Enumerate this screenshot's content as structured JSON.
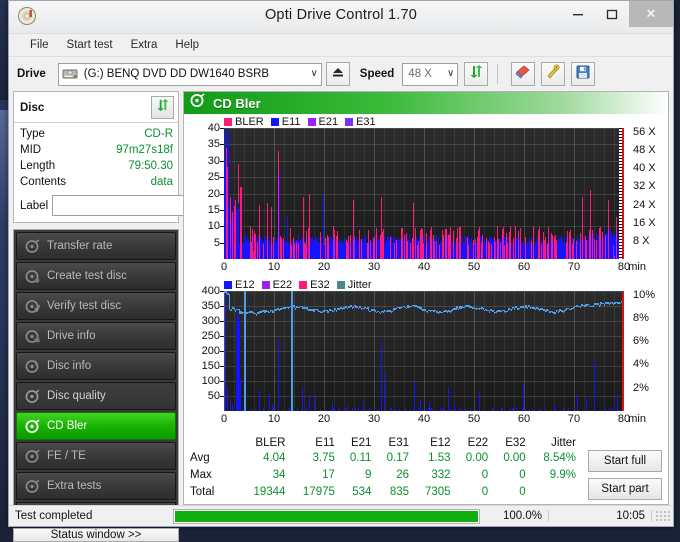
{
  "window": {
    "title": "Opti Drive Control 1.70",
    "app_icon": "disc-icon",
    "buttons": {
      "minimize": "–",
      "maximize": "□",
      "close": "✕"
    }
  },
  "menubar": {
    "items": [
      "File",
      "Start test",
      "Extra",
      "Help"
    ]
  },
  "toolbar": {
    "drive_label": "Drive",
    "drive_value": "(G:)   BENQ DVD DD DW1640 BSRB",
    "drive_icon": "drive-icon",
    "eject_icon": "eject-icon",
    "speed_label": "Speed",
    "speed_value": "48 X",
    "refresh_icon": "refresh-icon",
    "eraser_icon": "eraser-icon",
    "tools_icon": "tools-icon",
    "save_icon": "save-icon",
    "dropdown_arrow": "∨"
  },
  "disc_panel": {
    "title": "Disc",
    "refresh_icon": "refresh-icon",
    "rows": [
      {
        "key": "Type",
        "value": "CD-R"
      },
      {
        "key": "MID",
        "value": "97m27s18f"
      },
      {
        "key": "Length",
        "value": "79:50.30"
      },
      {
        "key": "Contents",
        "value": "data"
      }
    ],
    "label_key": "Label",
    "label_value": "",
    "label_placeholder": "",
    "cd_icon": "cd-icon"
  },
  "test_list": {
    "items": [
      {
        "label": "Transfer rate",
        "icon": "disc-test-icon",
        "active": false
      },
      {
        "label": "Create test disc",
        "icon": "disc-burn-icon",
        "active": false
      },
      {
        "label": "Verify test disc",
        "icon": "disc-verify-icon",
        "active": false
      },
      {
        "label": "Drive info",
        "icon": "drive-info-icon",
        "active": false
      },
      {
        "label": "Disc info",
        "icon": "disc-info-icon",
        "active": false
      },
      {
        "label": "Disc quality",
        "icon": "disc-quality-icon",
        "active": false
      },
      {
        "label": "CD Bler",
        "icon": "cd-bler-icon",
        "active": true
      },
      {
        "label": "FE / TE",
        "icon": "fe-te-icon",
        "active": false
      },
      {
        "label": "Extra tests",
        "icon": "extra-tests-icon",
        "active": false
      }
    ],
    "status_window_label": "Status window >>"
  },
  "main": {
    "panel_title": "CD Bler",
    "panel_icon": "cd-bler-icon",
    "start_full_label": "Start full",
    "start_part_label": "Start part"
  },
  "colors": {
    "bler": "#ff1a7a",
    "e11": "#1414ff",
    "e21": "#a020f0",
    "e31": "#7b2ff7",
    "e12": "#1414ff",
    "e22": "#a020f0",
    "e32": "#ff1a7a",
    "jitter": "#4d9ee8",
    "accent_green": "#16b000",
    "value_green": "#0a8f2c",
    "plot_bg": "#232323",
    "red_edge": "#e01010"
  },
  "statusbar": {
    "message": "Test completed",
    "percent_label": "100.0%",
    "percent_value": 100,
    "elapsed": "10:05"
  },
  "stats": {
    "columns": [
      "BLER",
      "E11",
      "E21",
      "E31",
      "E12",
      "E22",
      "E32",
      "Jitter"
    ],
    "rows": [
      {
        "name": "Avg",
        "values": [
          "4.04",
          "3.75",
          "0.11",
          "0.17",
          "1.53",
          "0.00",
          "0.00",
          "8.54%"
        ]
      },
      {
        "name": "Max",
        "values": [
          "34",
          "17",
          "9",
          "26",
          "332",
          "0",
          "0",
          "9.9%"
        ]
      },
      {
        "name": "Total",
        "values": [
          "19344",
          "17975",
          "534",
          "835",
          "7305",
          "0",
          "0",
          ""
        ]
      }
    ]
  },
  "chart_data": [
    {
      "type": "area",
      "id": "cd-bler-chart",
      "title": "CD Bler",
      "xlabel": "min",
      "ylabel": "",
      "xlim": [
        0,
        80
      ],
      "ylim": [
        0,
        40
      ],
      "xticks": [
        0,
        10,
        20,
        30,
        40,
        50,
        60,
        70,
        80
      ],
      "yticks": [
        5,
        10,
        15,
        20,
        25,
        30,
        35,
        40
      ],
      "y2label": "X",
      "y2ticks": [
        "8 X",
        "16 X",
        "24 X",
        "32 X",
        "40 X",
        "48 X",
        "56 X"
      ],
      "y2lim": [
        0,
        56
      ],
      "grid": true,
      "legend": [
        {
          "name": "BLER",
          "color": "#ff1a7a"
        },
        {
          "name": "E11",
          "color": "#1414ff"
        },
        {
          "name": "E21",
          "color": "#a020f0"
        },
        {
          "name": "E31",
          "color": "#7b2ff7"
        }
      ],
      "notes": "Dense noise band: E11 (blue) fill avg ~4-8, BLER (pink) spikes to 34 near 0 min and 33 near 11 min; baseline rises slightly after 70 min.",
      "seed": 1337,
      "series": [
        {
          "name": "E11",
          "color": "#1414ff",
          "baseline": 5.5,
          "noise": 3.2,
          "avg": 3.75,
          "max": 17
        },
        {
          "name": "BLER",
          "color": "#ff1a7a",
          "baseline": 6.0,
          "noise": 6.0,
          "avg": 4.04,
          "max": 34
        }
      ],
      "spikes": [
        {
          "x": 0.3,
          "y": 34,
          "color": "#ff1a7a"
        },
        {
          "x": 0.6,
          "y": 28,
          "color": "#ff1a7a"
        },
        {
          "x": 2.8,
          "y": 29,
          "color": "#ff1a7a"
        },
        {
          "x": 3.1,
          "y": 22,
          "color": "#ff1a7a"
        },
        {
          "x": 3.4,
          "y": 22,
          "color": "#ff1a7a"
        },
        {
          "x": 2.9,
          "y": 17,
          "color": "#1414ff"
        },
        {
          "x": 7.0,
          "y": 16.5,
          "color": "#ff1a7a"
        },
        {
          "x": 8.6,
          "y": 17,
          "color": "#ff1a7a"
        },
        {
          "x": 9.3,
          "y": 16,
          "color": "#ff1a7a"
        },
        {
          "x": 10.8,
          "y": 33,
          "color": "#ff1a7a"
        },
        {
          "x": 10.9,
          "y": 26,
          "color": "#1414ff"
        },
        {
          "x": 12.6,
          "y": 13,
          "color": "#1414ff"
        },
        {
          "x": 15.8,
          "y": 19,
          "color": "#ff1a7a"
        },
        {
          "x": 16.9,
          "y": 20,
          "color": "#ff1a7a"
        },
        {
          "x": 19.8,
          "y": 20,
          "color": "#1414ff"
        },
        {
          "x": 25.8,
          "y": 18,
          "color": "#ff1a7a"
        },
        {
          "x": 31.4,
          "y": 19,
          "color": "#ff1a7a"
        },
        {
          "x": 37.8,
          "y": 17,
          "color": "#ff1a7a"
        },
        {
          "x": 71.5,
          "y": 19,
          "color": "#ff1a7a"
        },
        {
          "x": 73.2,
          "y": 21,
          "color": "#ff1a7a"
        },
        {
          "x": 76.8,
          "y": 18,
          "color": "#ff1a7a"
        },
        {
          "x": 79.2,
          "y": 24,
          "color": "#ff1a7a"
        }
      ]
    },
    {
      "type": "line",
      "id": "e12-jitter-chart",
      "title": "E12 / Jitter",
      "xlabel": "min",
      "ylabel": "",
      "xlim": [
        0,
        80
      ],
      "ylim": [
        0,
        400
      ],
      "xticks": [
        0,
        10,
        20,
        30,
        40,
        50,
        60,
        70,
        80
      ],
      "yticks": [
        50,
        100,
        150,
        200,
        250,
        300,
        350,
        400
      ],
      "y2label": "%",
      "y2ticks": [
        "2%",
        "4%",
        "6%",
        "8%",
        "10%"
      ],
      "y2lim": [
        0,
        10
      ],
      "grid": true,
      "legend": [
        {
          "name": "E12",
          "color": "#1414ff"
        },
        {
          "name": "E22",
          "color": "#a020f0"
        },
        {
          "name": "E32",
          "color": "#ff1a7a"
        },
        {
          "name": "Jitter",
          "color": "#4a8a8a"
        }
      ],
      "notes": "Jitter trace (light blue) hovers 8.2-9.0% (≈330-360 on left scale), dips to ~8.2% around 4-6 min, rises to ~9.9% at 80 min. E12 spikes: 400 at 0, ~320 cluster near 2.5-3 min, 237 at 10.8, 380 at 13.4, 230 at 31.4, 128 at 32, 98 at 38.",
      "jitter": {
        "name": "Jitter",
        "color": "#4d9ee8",
        "avg_percent": 8.54,
        "max_percent": 9.9,
        "baseline_left_scale": 340,
        "noise": 12
      },
      "spikes": [
        {
          "x": 0.1,
          "y": 400,
          "color": "#1414ff"
        },
        {
          "x": 0.5,
          "y": 78,
          "color": "#1414ff"
        },
        {
          "x": 1.2,
          "y": 40,
          "color": "#1414ff"
        },
        {
          "x": 2.4,
          "y": 300,
          "color": "#1414ff"
        },
        {
          "x": 2.6,
          "y": 332,
          "color": "#1414ff"
        },
        {
          "x": 2.8,
          "y": 318,
          "color": "#1414ff"
        },
        {
          "x": 3.0,
          "y": 300,
          "color": "#1414ff"
        },
        {
          "x": 3.2,
          "y": 110,
          "color": "#1414ff"
        },
        {
          "x": 3.9,
          "y": 175,
          "color": "#1414ff"
        },
        {
          "x": 7.0,
          "y": 68,
          "color": "#1414ff"
        },
        {
          "x": 8.9,
          "y": 58,
          "color": "#1414ff"
        },
        {
          "x": 9.5,
          "y": 22,
          "color": "#1414ff"
        },
        {
          "x": 10.8,
          "y": 237,
          "color": "#1414ff"
        },
        {
          "x": 13.4,
          "y": 380,
          "color": "#1414ff"
        },
        {
          "x": 15.6,
          "y": 83,
          "color": "#1414ff"
        },
        {
          "x": 17.0,
          "y": 52,
          "color": "#1414ff"
        },
        {
          "x": 18.2,
          "y": 48,
          "color": "#1414ff"
        },
        {
          "x": 21.6,
          "y": 30,
          "color": "#1414ff"
        },
        {
          "x": 24.5,
          "y": 18,
          "color": "#1414ff"
        },
        {
          "x": 27.8,
          "y": 34,
          "color": "#1414ff"
        },
        {
          "x": 31.4,
          "y": 230,
          "color": "#1414ff"
        },
        {
          "x": 32.1,
          "y": 128,
          "color": "#1414ff"
        },
        {
          "x": 38.0,
          "y": 98,
          "color": "#1414ff"
        },
        {
          "x": 39.2,
          "y": 40,
          "color": "#1414ff"
        },
        {
          "x": 41.0,
          "y": 30,
          "color": "#1414ff"
        },
        {
          "x": 44.8,
          "y": 78,
          "color": "#1414ff"
        },
        {
          "x": 46.0,
          "y": 26,
          "color": "#1414ff"
        },
        {
          "x": 51.0,
          "y": 62,
          "color": "#1414ff"
        },
        {
          "x": 59.8,
          "y": 88,
          "color": "#1414ff"
        },
        {
          "x": 66.0,
          "y": 20,
          "color": "#1414ff"
        },
        {
          "x": 70.6,
          "y": 58,
          "color": "#1414ff"
        },
        {
          "x": 72.4,
          "y": 44,
          "color": "#1414ff"
        },
        {
          "x": 74.0,
          "y": 175,
          "color": "#1414ff"
        },
        {
          "x": 78.6,
          "y": 52,
          "color": "#1414ff"
        },
        {
          "x": 79.6,
          "y": 60,
          "color": "#1414ff"
        }
      ]
    }
  ]
}
